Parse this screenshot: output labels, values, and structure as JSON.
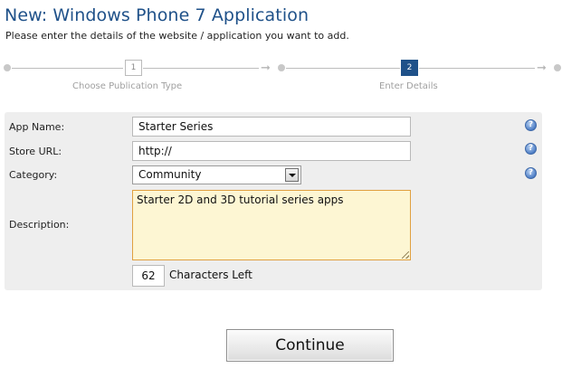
{
  "header": {
    "title": "New: Windows Phone 7 Application",
    "subtitle": "Please enter the details of the website / application you want to add."
  },
  "wizard": {
    "steps": [
      {
        "number": "1",
        "label": "Choose Publication Type",
        "state": "inactive"
      },
      {
        "number": "2",
        "label": "Enter Details",
        "state": "active"
      }
    ],
    "arrow_glyph": "➞"
  },
  "form": {
    "app_name": {
      "label": "App Name:",
      "value": "Starter Series"
    },
    "store_url": {
      "label": "Store URL:",
      "value": "http://"
    },
    "category": {
      "label": "Category:",
      "value": "Community"
    },
    "description": {
      "label": "Description:",
      "value": "Starter 2D and 3D tutorial series apps"
    },
    "characters_left": {
      "value": "62",
      "label": "Characters Left"
    },
    "help_glyph": "?"
  },
  "actions": {
    "continue_label": "Continue"
  },
  "colors": {
    "title": "#1f5189",
    "active_step": "#1f5189",
    "panel_background": "#eeeeee",
    "textarea_background": "#fdf6d3",
    "textarea_border": "#e0a040"
  },
  "icons": {
    "help": "help-icon",
    "dropdown": "chevron-down-icon",
    "step_arrow": "arrow-right-icon"
  }
}
